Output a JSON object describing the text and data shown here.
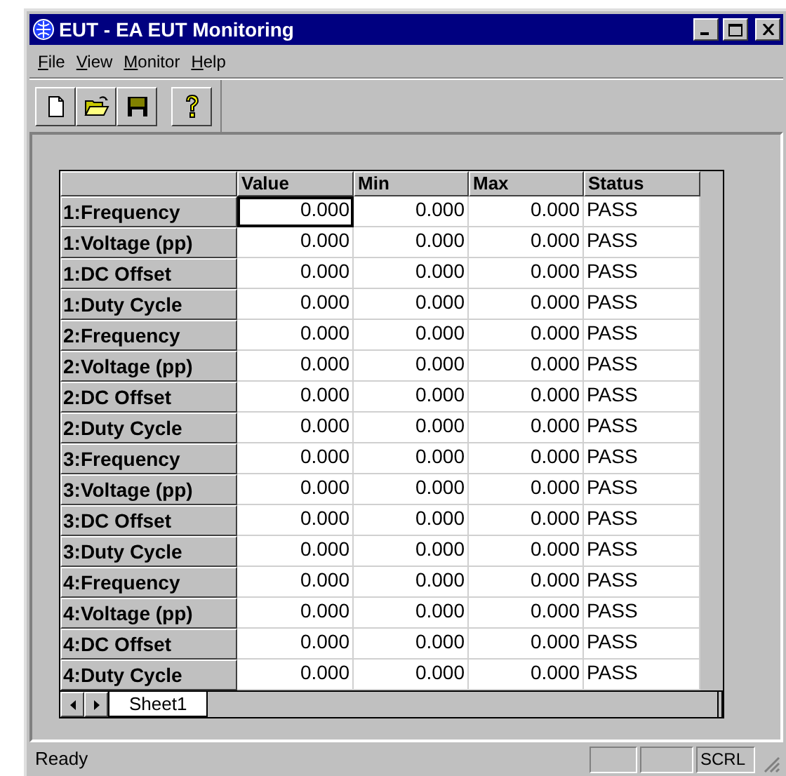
{
  "window": {
    "title": "EUT - EA EUT Monitoring"
  },
  "menu": [
    {
      "label": "File"
    },
    {
      "label": "View"
    },
    {
      "label": "Monitor"
    },
    {
      "label": "Help"
    }
  ],
  "toolbar": [
    {
      "kind": "new"
    },
    {
      "kind": "open"
    },
    {
      "kind": "save"
    },
    {
      "kind": "separator"
    },
    {
      "kind": "help"
    }
  ],
  "table": {
    "columns": [
      "Value",
      "Min",
      "Max",
      "Status"
    ],
    "rows": [
      {
        "label": "1:Frequency",
        "value": "0.000",
        "min": "0.000",
        "max": "0.000",
        "status": "PASS",
        "selected": true
      },
      {
        "label": "1:Voltage (pp)",
        "value": "0.000",
        "min": "0.000",
        "max": "0.000",
        "status": "PASS",
        "selected": false
      },
      {
        "label": "1:DC Offset",
        "value": "0.000",
        "min": "0.000",
        "max": "0.000",
        "status": "PASS",
        "selected": false
      },
      {
        "label": "1:Duty Cycle",
        "value": "0.000",
        "min": "0.000",
        "max": "0.000",
        "status": "PASS",
        "selected": false
      },
      {
        "label": "2:Frequency",
        "value": "0.000",
        "min": "0.000",
        "max": "0.000",
        "status": "PASS",
        "selected": false
      },
      {
        "label": "2:Voltage (pp)",
        "value": "0.000",
        "min": "0.000",
        "max": "0.000",
        "status": "PASS",
        "selected": false
      },
      {
        "label": "2:DC Offset",
        "value": "0.000",
        "min": "0.000",
        "max": "0.000",
        "status": "PASS",
        "selected": false
      },
      {
        "label": "2:Duty Cycle",
        "value": "0.000",
        "min": "0.000",
        "max": "0.000",
        "status": "PASS",
        "selected": false
      },
      {
        "label": "3:Frequency",
        "value": "0.000",
        "min": "0.000",
        "max": "0.000",
        "status": "PASS",
        "selected": false
      },
      {
        "label": "3:Voltage (pp)",
        "value": "0.000",
        "min": "0.000",
        "max": "0.000",
        "status": "PASS",
        "selected": false
      },
      {
        "label": "3:DC Offset",
        "value": "0.000",
        "min": "0.000",
        "max": "0.000",
        "status": "PASS",
        "selected": false
      },
      {
        "label": "3:Duty Cycle",
        "value": "0.000",
        "min": "0.000",
        "max": "0.000",
        "status": "PASS",
        "selected": false
      },
      {
        "label": "4:Frequency",
        "value": "0.000",
        "min": "0.000",
        "max": "0.000",
        "status": "PASS",
        "selected": false
      },
      {
        "label": "4:Voltage (pp)",
        "value": "0.000",
        "min": "0.000",
        "max": "0.000",
        "status": "PASS",
        "selected": false
      },
      {
        "label": "4:DC Offset",
        "value": "0.000",
        "min": "0.000",
        "max": "0.000",
        "status": "PASS",
        "selected": false
      },
      {
        "label": "4:Duty Cycle",
        "value": "0.000",
        "min": "0.000",
        "max": "0.000",
        "status": "PASS",
        "selected": false
      }
    ]
  },
  "sheet_tabs": [
    {
      "label": "Sheet1",
      "selected": true
    }
  ],
  "status_bar": {
    "text": "Ready",
    "panels": [
      {
        "kind": "empty"
      },
      {
        "kind": "empty"
      },
      {
        "kind": "text",
        "label": "SCRL"
      }
    ]
  }
}
